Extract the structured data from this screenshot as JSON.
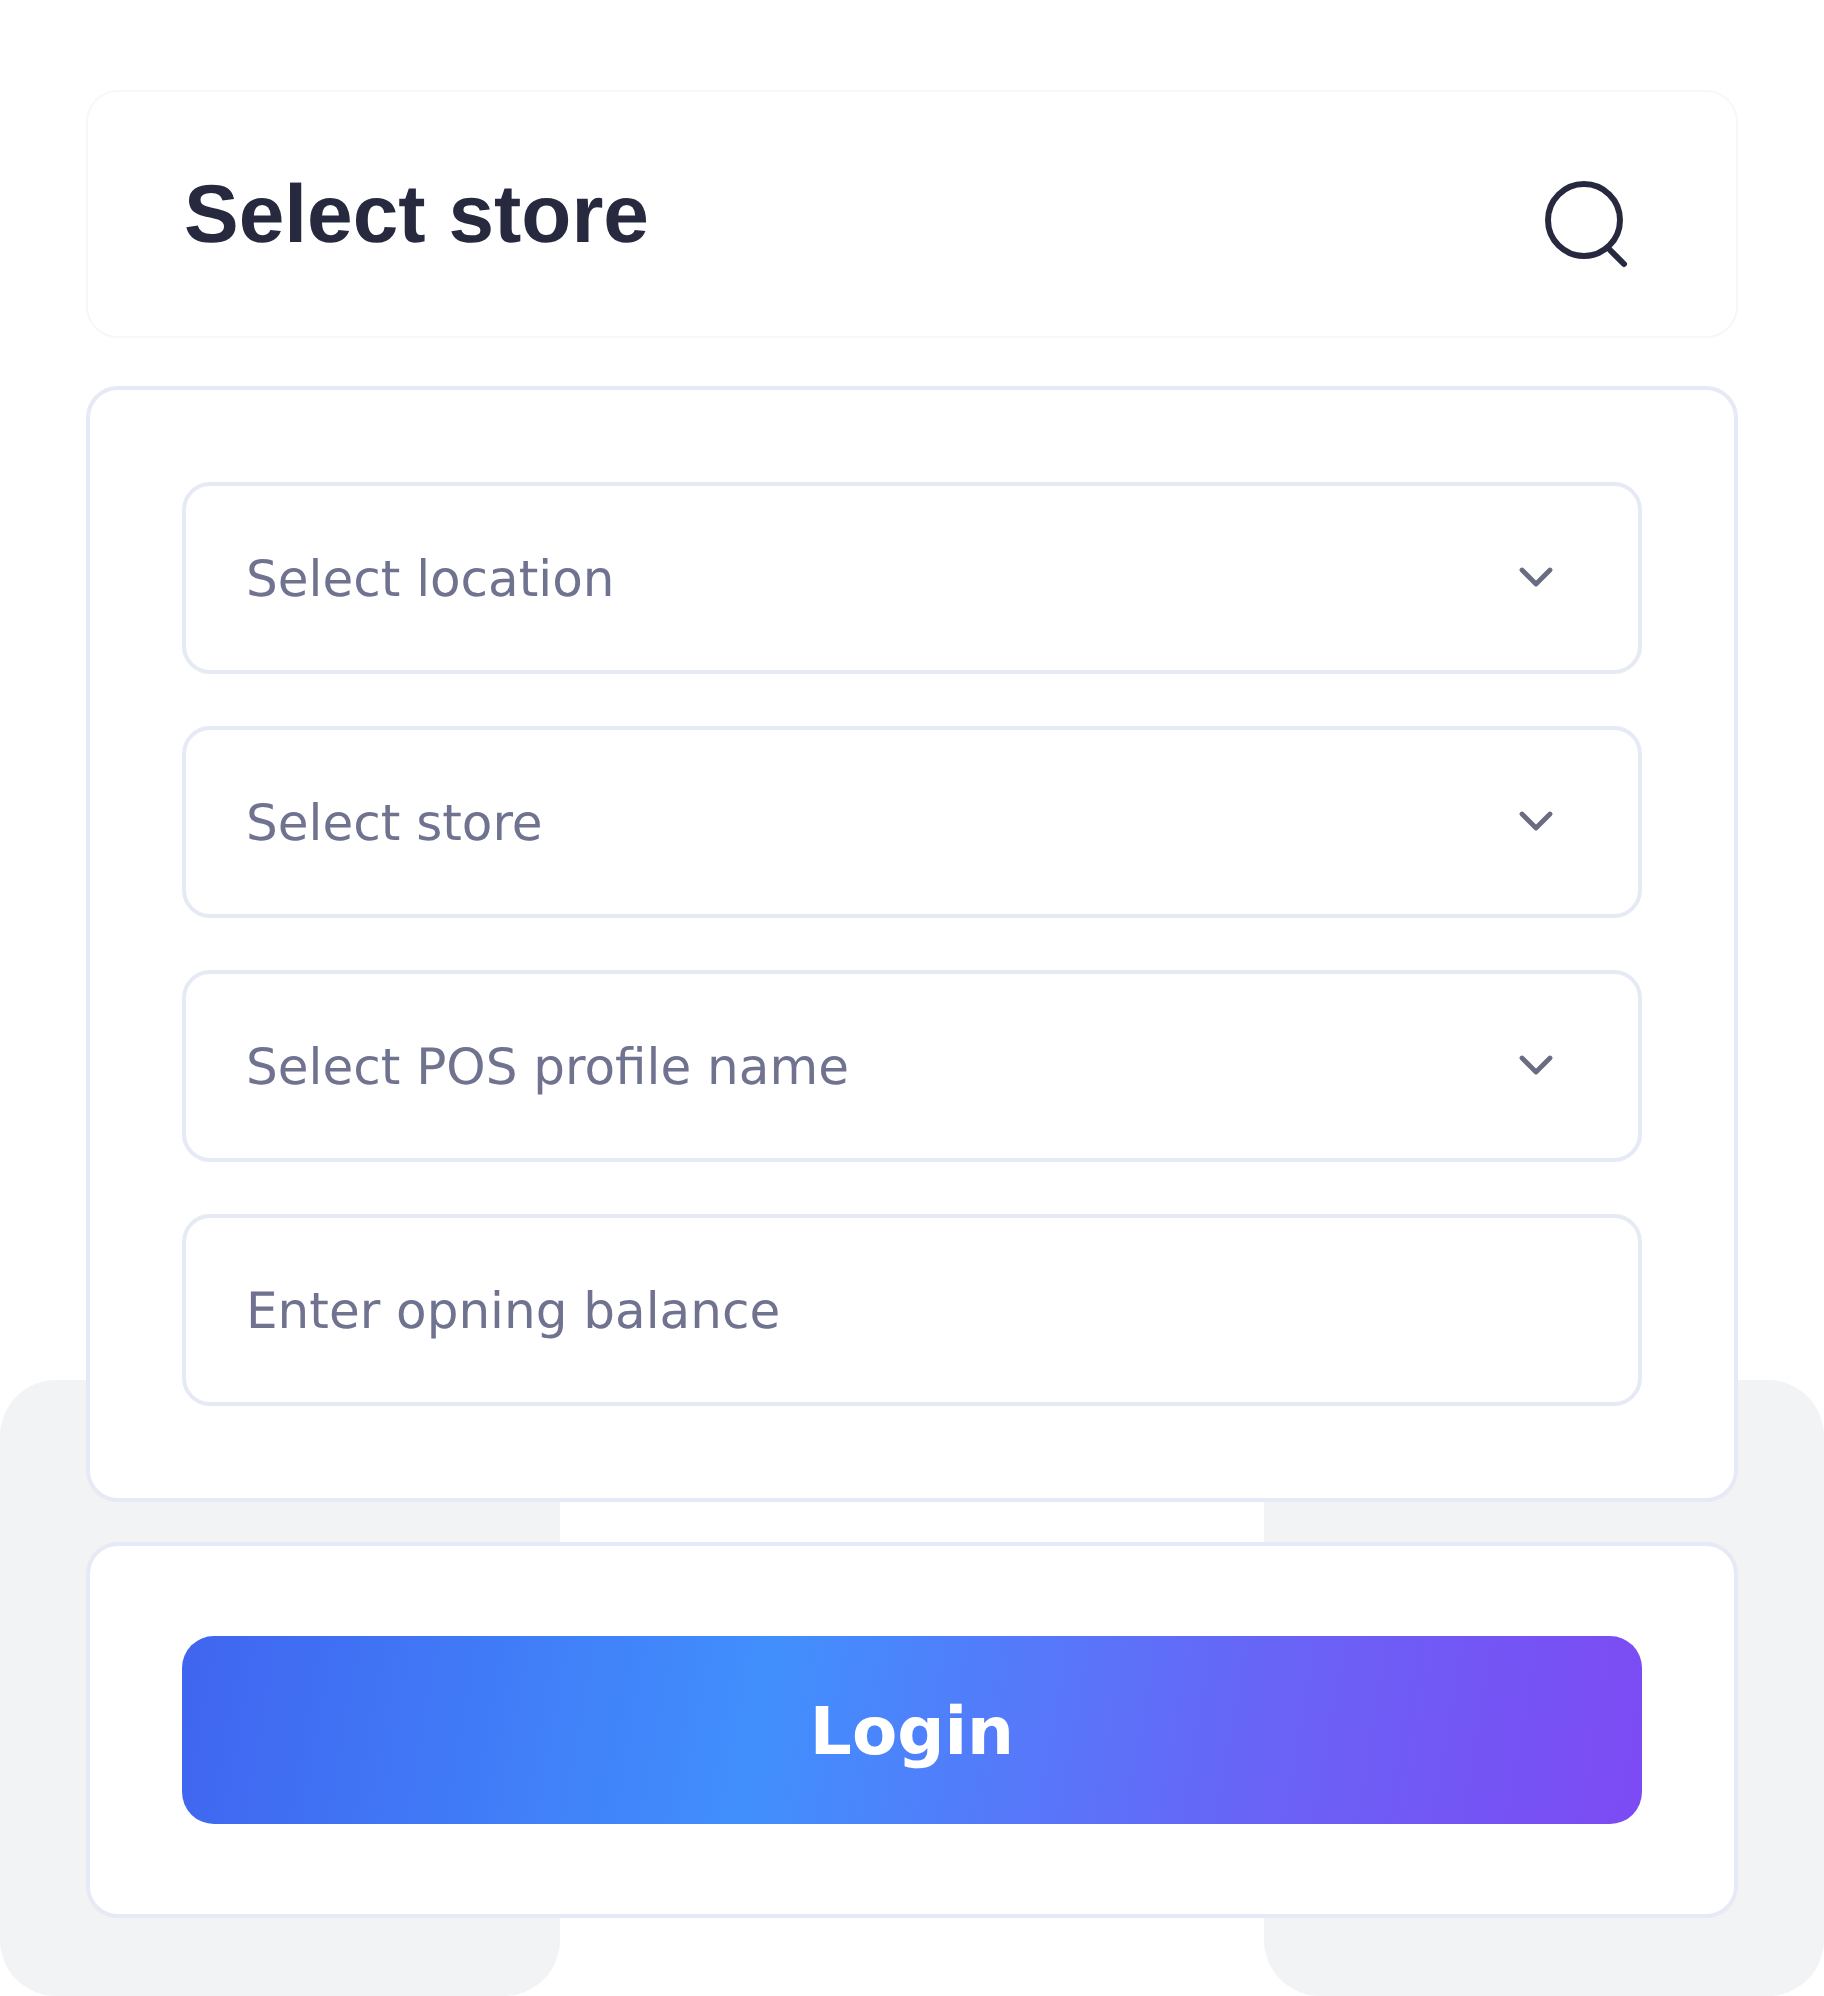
{
  "header": {
    "title": "Select store"
  },
  "fields": [
    {
      "kind": "select",
      "placeholder": "Select location"
    },
    {
      "kind": "select",
      "placeholder": "Select store"
    },
    {
      "kind": "select",
      "placeholder": "Select POS profile name"
    },
    {
      "kind": "input",
      "placeholder": "Enter opning balance"
    }
  ],
  "login_button": {
    "label": "Login"
  }
}
